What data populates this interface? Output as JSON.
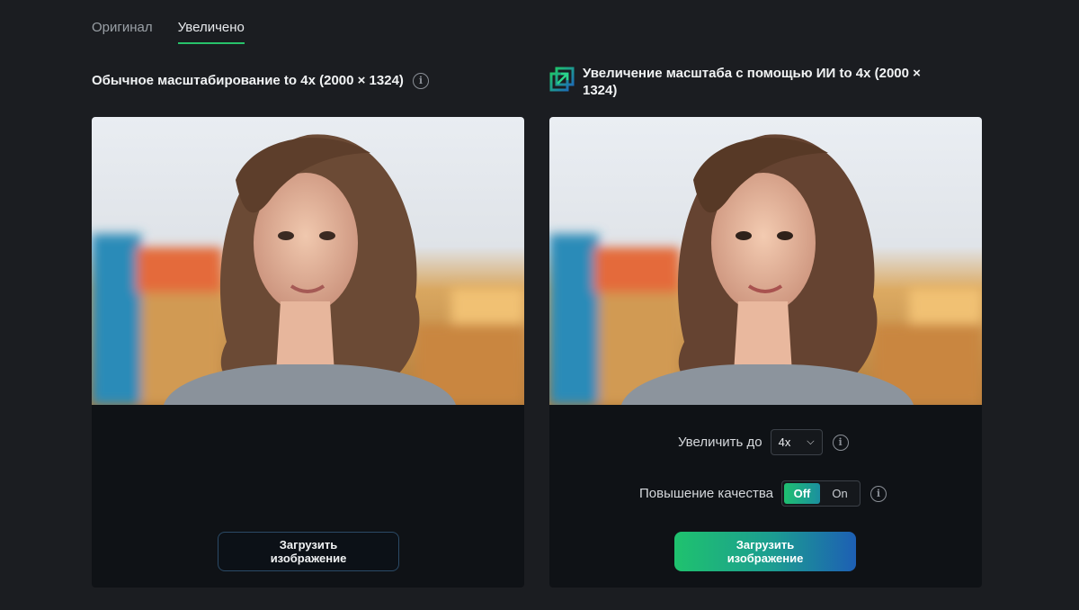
{
  "tabs": [
    {
      "label": "Оригинал",
      "active": false
    },
    {
      "label": "Увеличено",
      "active": true
    }
  ],
  "left": {
    "title": "Обычное масштабирование to 4x (2000 × 1324)",
    "button": "Загрузить\nизображение"
  },
  "right": {
    "title": "Увеличение масштаба с помощью ИИ to 4x (2000 ×\n1324)",
    "scale_label": "Увеличить до",
    "scale_value": "4x",
    "quality_label": "Повышение качества",
    "toggle_off": "Off",
    "toggle_on": "On",
    "button": "Загрузить\nизображение"
  },
  "colors": {
    "accent_green": "#27c26a",
    "gradient_start": "#1fc26e",
    "gradient_end": "#1d5fb4"
  },
  "icons": {
    "info": "info-icon",
    "ai": "ai-upscale-icon",
    "dropdown": "chevron-down-icon"
  }
}
